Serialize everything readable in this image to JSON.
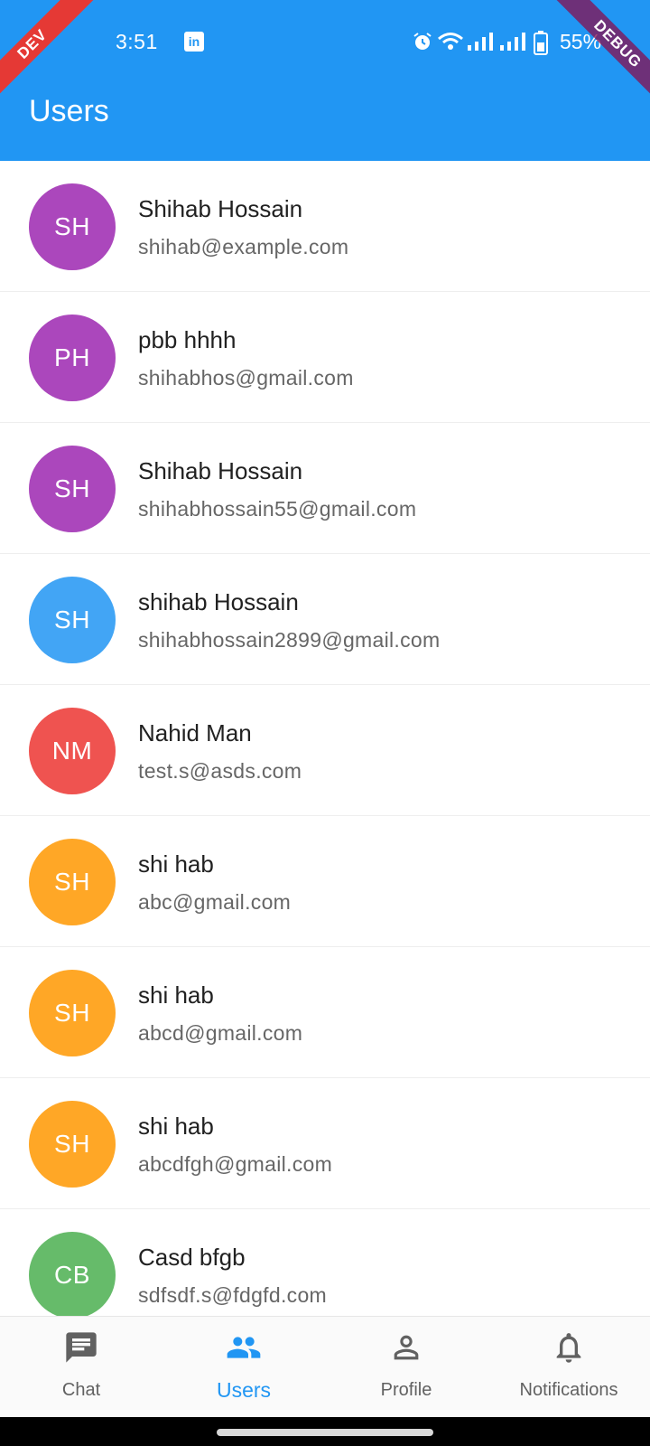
{
  "status_bar": {
    "time": "3:51",
    "battery": "55%"
  },
  "banners": {
    "left": "DEV",
    "right": "DEBUG"
  },
  "app_bar": {
    "title": "Users",
    "color": "#2196F3"
  },
  "users": [
    {
      "initials": "SH",
      "name": "Shihab Hossain",
      "email": "shihab@example.com",
      "color": "#AB47BC"
    },
    {
      "initials": "PH",
      "name": "pbb hhhh",
      "email": "shihabhos@gmail.com",
      "color": "#AB47BC"
    },
    {
      "initials": "SH",
      "name": "Shihab Hossain",
      "email": "shihabhossain55@gmail.com",
      "color": "#AB47BC"
    },
    {
      "initials": "SH",
      "name": "shihab Hossain",
      "email": "shihabhossain2899@gmail.com",
      "color": "#42A5F5"
    },
    {
      "initials": "NM",
      "name": "Nahid Man",
      "email": "test.s@asds.com",
      "color": "#EF5350"
    },
    {
      "initials": "SH",
      "name": "shi hab",
      "email": "abc@gmail.com",
      "color": "#FFA726"
    },
    {
      "initials": "SH",
      "name": "shi hab",
      "email": "abcd@gmail.com",
      "color": "#FFA726"
    },
    {
      "initials": "SH",
      "name": "shi hab",
      "email": "abcdfgh@gmail.com",
      "color": "#FFA726"
    },
    {
      "initials": "CB",
      "name": "Casd bfgb",
      "email": "sdfsdf.s@fdgfd.com",
      "color": "#66BB6A"
    }
  ],
  "bottom_nav": {
    "items": [
      {
        "label": "Chat",
        "icon": "chat-icon",
        "active": false
      },
      {
        "label": "Users",
        "icon": "users-icon",
        "active": true
      },
      {
        "label": "Profile",
        "icon": "profile-icon",
        "active": false
      },
      {
        "label": "Notifications",
        "icon": "bell-icon",
        "active": false
      }
    ],
    "active_color": "#2196F3",
    "inactive_color": "#616161"
  }
}
